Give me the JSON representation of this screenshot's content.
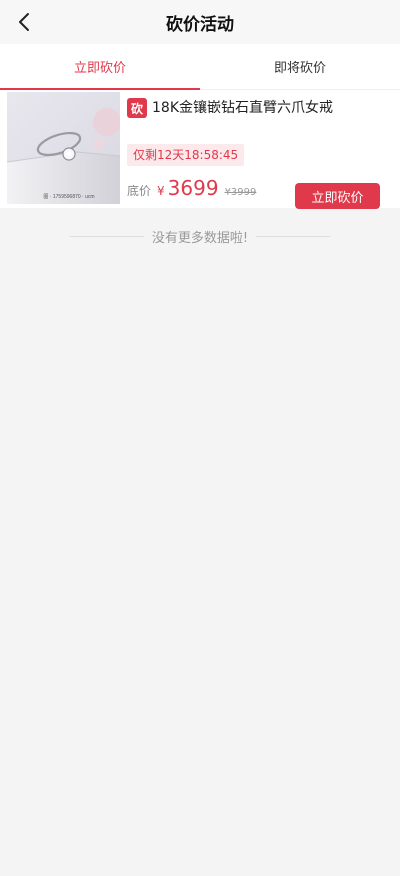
{
  "header": {
    "title": "砍价活动",
    "back_icon": "chevron-left-icon"
  },
  "tabs": [
    {
      "label": "立即砍价",
      "active": true
    },
    {
      "label": "即将砍价",
      "active": false
    }
  ],
  "product": {
    "badge": "砍",
    "name": "18K金镶嵌钻石直臂六爪女戒",
    "countdown": "仅剩12天18:58:45",
    "price_label": "底价",
    "price_symbol": "¥",
    "price": "3699",
    "original_price": "¥3999",
    "button_label": "立即砍价",
    "image": "diamond-ring-photo"
  },
  "footer": {
    "no_more": "没有更多数据啦!"
  },
  "colors": {
    "accent": "#e0394b",
    "countdown_bg": "#fce9ec",
    "page_bg": "#f4f4f4"
  }
}
